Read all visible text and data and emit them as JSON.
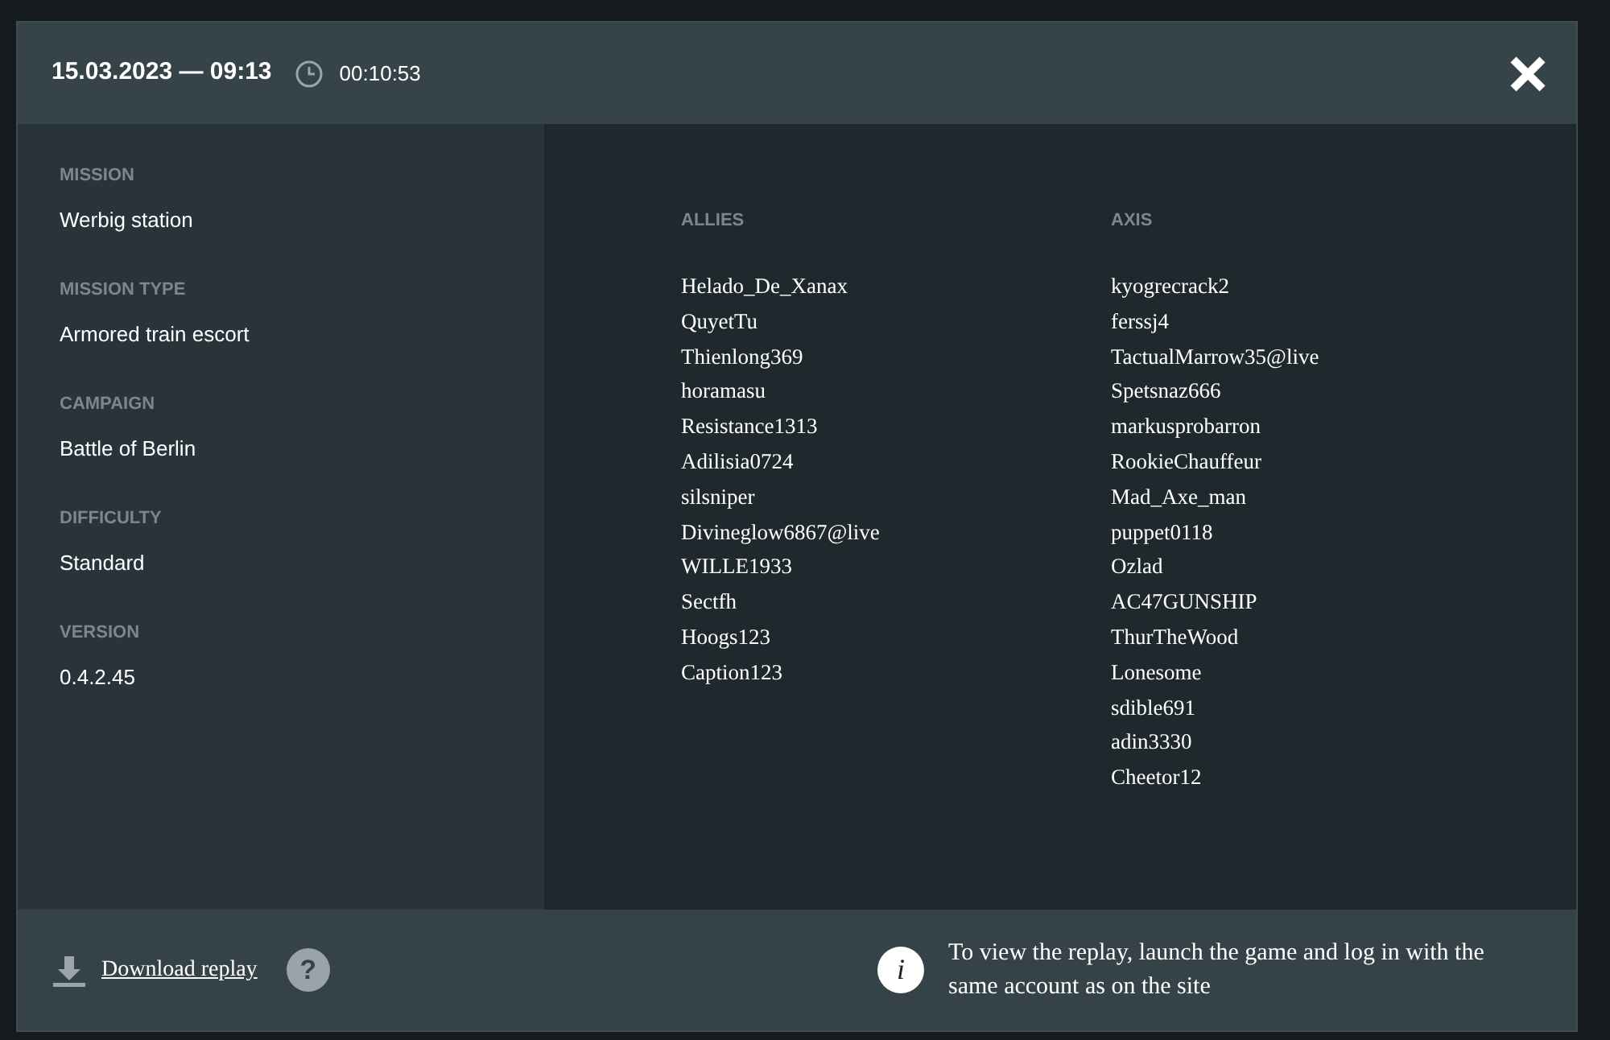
{
  "header": {
    "datetime": "15.03.2023 — 09:13",
    "duration": "00:10:53"
  },
  "details": [
    {
      "label": "MISSION",
      "value": "Werbig station"
    },
    {
      "label": "MISSION TYPE",
      "value": "Armored train escort"
    },
    {
      "label": "CAMPAIGN",
      "value": "Battle of Berlin"
    },
    {
      "label": "DIFFICULTY",
      "value": "Standard"
    },
    {
      "label": "VERSION",
      "value": "0.4.2.45"
    }
  ],
  "teams": [
    {
      "name": "ALLIES",
      "players": [
        "Helado_De_Xanax",
        "QuyetTu",
        "Thienlong369",
        "horamasu",
        "Resistance1313",
        "Adilisia0724",
        "silsniper",
        "Divineglow6867@live",
        "WILLE1933",
        "Sectfh",
        "Hoogs123",
        "Caption123"
      ]
    },
    {
      "name": "AXIS",
      "players": [
        "kyogrecrack2",
        "ferssj4",
        "TactualMarrow35@live",
        "Spetsnaz666",
        "markusprobarron",
        "RookieChauffeur",
        "Mad_Axe_man",
        "puppet0118",
        "Ozlad",
        "AC47GUNSHIP",
        "ThurTheWood",
        "Lonesome",
        "sdible691",
        "adin3330",
        "Cheetor12"
      ]
    }
  ],
  "footer": {
    "download_link": "Download replay",
    "help_icon": "?",
    "info_icon": "i",
    "info_text": "To view the replay, launch the game and log in with the same account as on the site"
  }
}
